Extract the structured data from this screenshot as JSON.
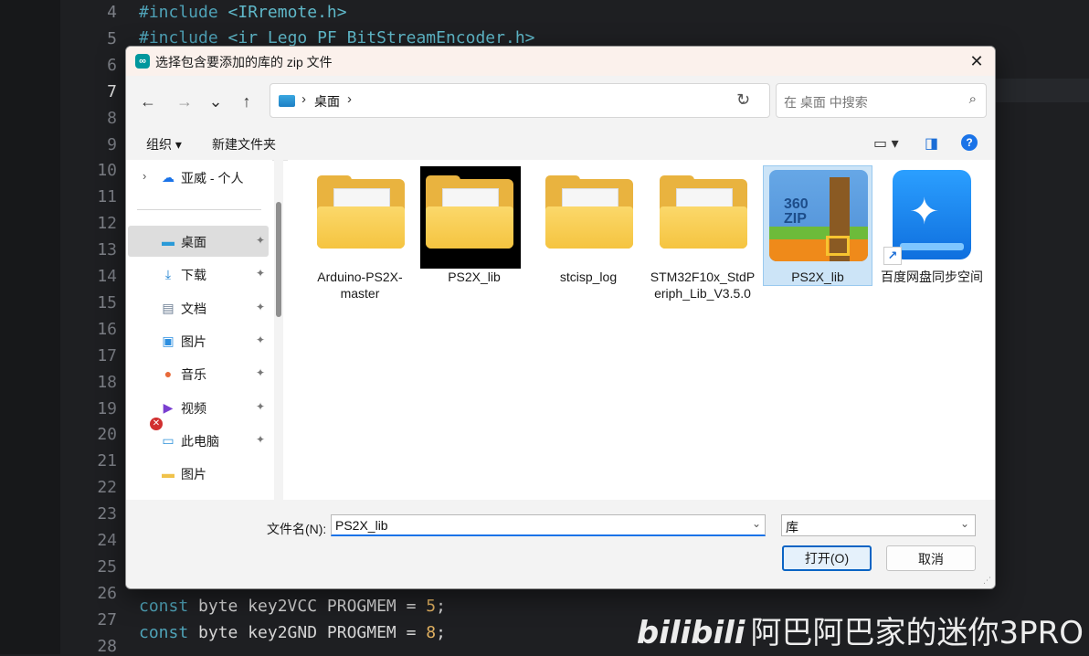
{
  "editor": {
    "line_numbers": [
      "4",
      "5",
      "6",
      "7",
      "8",
      "9",
      "10",
      "11",
      "12",
      "13",
      "14",
      "15",
      "16",
      "17",
      "18",
      "19",
      "20",
      "21",
      "22",
      "23",
      "24",
      "25",
      "26",
      "27",
      "28"
    ],
    "current_line": "7",
    "line4": {
      "kw": "#include",
      "str": "<IRremote.h>"
    },
    "line5": {
      "kw": "#include",
      "str": "<ir_Lego_PF_BitStreamEncoder.h>"
    },
    "line27": {
      "kw": "const",
      "rest": " byte key2VCC PROGMEM = ",
      "num": "5",
      "end": ";"
    },
    "line28": {
      "kw": "const",
      "rest": " byte key2GND PROGMEM = ",
      "num": "8",
      "end": ";"
    }
  },
  "watermark": {
    "logo": "bilibili",
    "text": "阿巴阿巴家的迷你3PRO"
  },
  "dialog": {
    "title": "选择包含要添加的库的 zip 文件",
    "close_glyph": "✕",
    "nav": {
      "back": "←",
      "forward": "→",
      "recent": "⌄",
      "up": "↑",
      "refresh": "↻"
    },
    "address": {
      "location": "桌面",
      "sep": "›",
      "drop": "⌄"
    },
    "search": {
      "placeholder": "在 桌面 中搜索",
      "icon": "⌕"
    },
    "toolbar": {
      "organize": "组织 ▾",
      "new_folder": "新建文件夹",
      "view_icon": "▭ ▾",
      "pane_icon": "◨",
      "help": "?"
    },
    "sidebar": {
      "onedrive": "亚威 - 个人",
      "items": [
        {
          "label": "桌面",
          "icon": "▬",
          "color": "#2a9ad8",
          "pinned": true
        },
        {
          "label": "下载",
          "icon": "⤓",
          "color": "#1a7fd0",
          "pinned": true
        },
        {
          "label": "文档",
          "icon": "▤",
          "color": "#6a7c92",
          "pinned": true
        },
        {
          "label": "图片",
          "icon": "▣",
          "color": "#2d8fe0",
          "pinned": true
        },
        {
          "label": "音乐",
          "icon": "●",
          "color": "#e86a3a",
          "pinned": true
        },
        {
          "label": "视频",
          "icon": "▶",
          "color": "#7a3fd0",
          "pinned": true
        },
        {
          "label": "此电脑",
          "icon": "▭",
          "color": "#2a8fd8",
          "pinned": true
        },
        {
          "label": "图片",
          "icon": "▬",
          "color": "#f0c24a",
          "pinned": false
        }
      ],
      "pin_glyph": "📌",
      "error_badge": "✕"
    },
    "files": [
      {
        "label": "Arduino-PS2X-master",
        "kind": "folder"
      },
      {
        "label": "PS2X_lib",
        "kind": "folder-dark"
      },
      {
        "label": "stcisp_log",
        "kind": "folder"
      },
      {
        "label": "STM32F10x_StdPeriph_Lib_V3.5.0",
        "kind": "folder"
      },
      {
        "label": "PS2X_lib",
        "kind": "zip",
        "selected": true,
        "badge_line1": "360",
        "badge_line2": "ZIP"
      },
      {
        "label": "百度网盘同步空间",
        "kind": "baidu-shortcut",
        "shortcut": "↗"
      }
    ],
    "filename": {
      "label": "文件名(N):",
      "value": "PS2X_lib",
      "drop": "⌄"
    },
    "filetype": {
      "value": "库",
      "drop": "⌄"
    },
    "open_label": "打开(O)",
    "cancel_label": "取消"
  }
}
